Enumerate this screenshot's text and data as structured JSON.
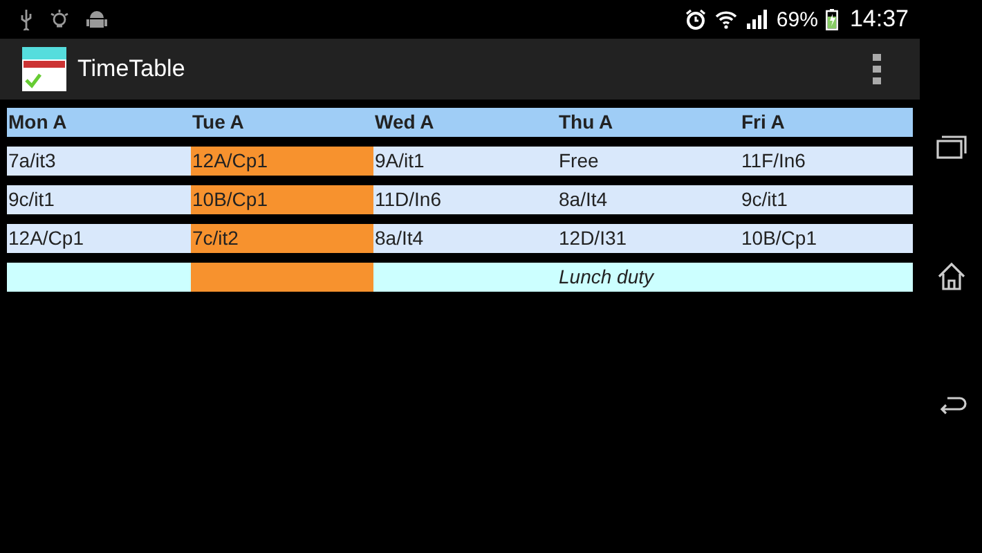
{
  "status_bar": {
    "battery": "69%",
    "time": "14:37"
  },
  "action_bar": {
    "title": "TimeTable"
  },
  "timetable": {
    "columns": [
      {
        "label": "Mon A",
        "selected": false
      },
      {
        "label": "Tue A",
        "selected": true
      },
      {
        "label": "Wed A",
        "selected": false
      },
      {
        "label": "Thu A",
        "selected": false
      },
      {
        "label": "Fri A",
        "selected": false
      }
    ],
    "rows": [
      {
        "kind": "lesson",
        "cells": [
          "7a/it3",
          "12A/Cp1",
          "9A/it1",
          "Free",
          "11F/In6"
        ]
      },
      {
        "kind": "lesson",
        "cells": [
          "9c/it1",
          "10B/Cp1",
          "11D/In6",
          "8a/It4",
          "9c/it1"
        ]
      },
      {
        "kind": "lesson",
        "cells": [
          "12A/Cp1",
          "7c/it2",
          "8a/It4",
          "12D/I31",
          "10B/Cp1"
        ]
      },
      {
        "kind": "duty",
        "cells": [
          null,
          null,
          null,
          "Lunch duty",
          null
        ]
      }
    ]
  }
}
